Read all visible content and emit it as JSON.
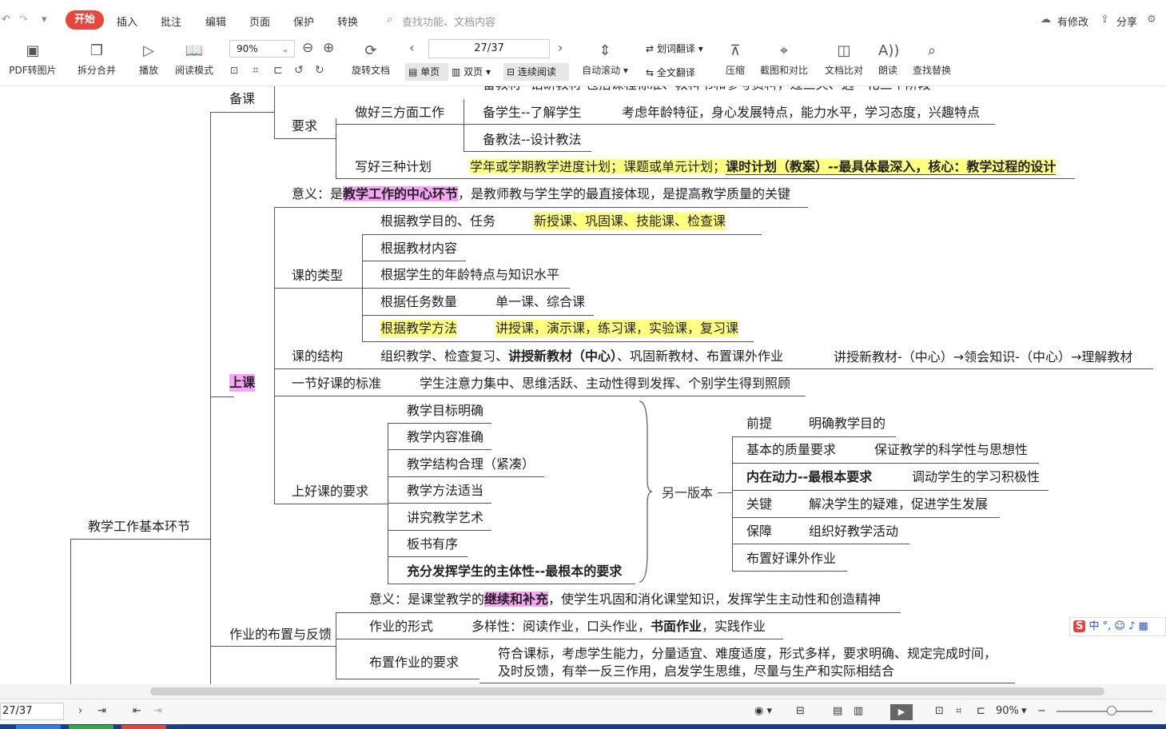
{
  "menu": {
    "undo_icon": "undo-icon",
    "tabs": [
      "开始",
      "插入",
      "批注",
      "编辑",
      "页面",
      "保护",
      "转换"
    ],
    "active_tab": "开始",
    "search_placeholder": "查找功能、文档内容",
    "modified": "有修改",
    "share": "分享"
  },
  "toolbar": {
    "pdf_to_image": "PDF转图片",
    "split_merge": "拆分合并",
    "play": "播放",
    "read_mode": "阅读模式",
    "zoom": "90%",
    "rotate": "旋转文档",
    "page": "27/37",
    "single": "单页",
    "double": "双页",
    "continuous": "连续阅读",
    "auto_scroll": "自动滚动",
    "word_translate": "划词翻译",
    "full_translate": "全文翻译",
    "compress": "压缩",
    "screenshot": "截图和对比",
    "compare": "文档比对",
    "read_aloud": "朗读",
    "find_replace": "查找替换"
  },
  "mindmap": {
    "root": "教学工作基本环节",
    "beike": "备课",
    "req": "要求",
    "top_cut": "备教材--钻研教材    包括课程标准、教科书和参考资料，过三关、选一化三个阶段",
    "three_work": "做好三方面工作",
    "bxs": "备学生--了解学生",
    "bxs_d": "考虑年龄特征，身心发展特点，能力水平，学习态度，兴趣特点",
    "bjf": "备教法--设计教法",
    "three_plan": "写好三种计划",
    "plan_1": "学年或学期教学进度计划；课题或单元计划；",
    "plan_2": "课时计划（教案）",
    "plan_3": "--最具体最深入，核心：教学过程的设计",
    "shangke": "上课",
    "meaning_1": "意义：是",
    "meaning_2": "教学工作的中心环节",
    "meaning_3": "，是教师教与学生学的最直接体现，是提高教学质量的关键",
    "type": "课的类型",
    "type_1": "根据教学目的、任务",
    "type_1d": "新授课、巩固课、技能课、检查课",
    "type_2": "根据教材内容",
    "type_3": "根据学生的年龄特点与知识水平",
    "type_4": "根据任务数量",
    "type_4d": "单一课、综合课",
    "type_5": "根据教学方法",
    "type_5d": "讲授课，演示课，练习课，实验课，复习课",
    "structure": "课的结构",
    "structure_1": "组织教学、检查复习、",
    "structure_2": "讲授新教材（中心）",
    "structure_3": "、巩固新教材、布置课外作业",
    "structure_side": "讲授新教材-（中心）→领会知识-（中心）→理解教材",
    "good": "一节好课的标准",
    "good_d": "学生注意力集中、思维活跃、主动性得到发挥、个别学生得到照顾",
    "good_req": "上好课的要求",
    "gr_1": "教学目标明确",
    "gr_2": "教学内容准确",
    "gr_3": "教学结构合理（紧凑）",
    "gr_4": "教学方法适当",
    "gr_5": "讲究教学艺术",
    "gr_6": "板书有序",
    "gr_7": "充分发挥学生的主体性--最根本的要求",
    "alt": "另一版本",
    "alt_1": "前提",
    "alt_1d": "明确教学目的",
    "alt_2": "基本的质量要求",
    "alt_2d": "保证教学的科学性与思想性",
    "alt_3": "内在动力--最根本要求",
    "alt_3d": "调动学生的学习积极性",
    "alt_4": "关键",
    "alt_4d": "解决学生的疑难，促进学生发展",
    "alt_5": "保障",
    "alt_5d": "组织好教学活动",
    "alt_6": "布置好课外作业",
    "hw": "作业的布置与反馈",
    "hw_m1": "意义：是课堂教学的",
    "hw_m2": "继续和补充",
    "hw_m3": "，使学生巩固和消化课堂知识，发挥学生主动性和创造精神",
    "hw_form": "作业的形式",
    "hw_form_1": "多样性：阅读作业，口头作业，",
    "hw_form_2": "书面作业",
    "hw_form_3": "，实践作业",
    "hw_req": "布置作业的要求",
    "hw_req_1": "符合课标，考虑学生能力，分量适宜、难度适度，形式多样，要求明确、规定完成时间，",
    "hw_req_2": "及时反馈，有举一反三作用，启发学生思维，尽量与生产和实际相结合"
  },
  "ime": {
    "label": "中"
  },
  "status": {
    "page": "27/37",
    "zoom": "90%"
  },
  "colors": {
    "active_tab": "#e8453c",
    "highlight_yellow": "#ffff80",
    "highlight_pink": "#f6a6f6"
  }
}
